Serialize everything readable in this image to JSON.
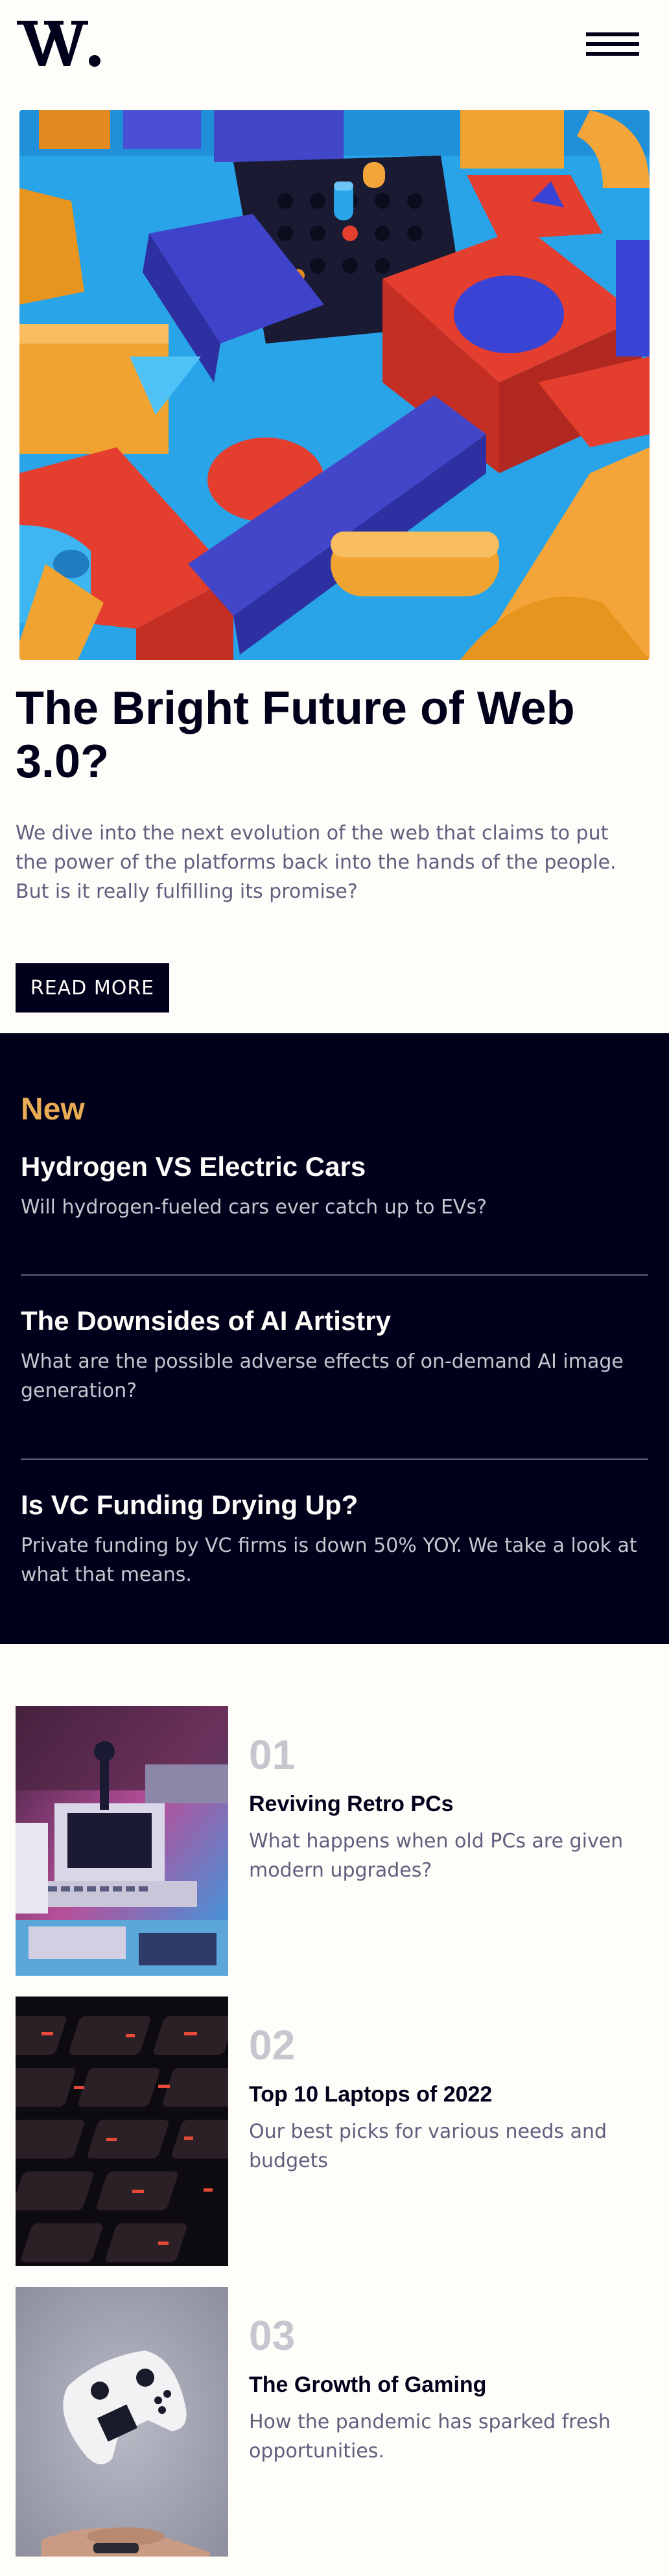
{
  "brand": {
    "logo_text": "W."
  },
  "colors": {
    "background": "#FFFDF9",
    "dark": "#00001A",
    "accent_orange": "#E9AB53",
    "grayish_blue": "#5E607E",
    "light_gray": "#C5C6CE"
  },
  "header": {
    "menu_icon": "hamburger-menu-icon"
  },
  "hero": {
    "image_description_icon": "abstract-3d-blocks-image",
    "title": "The Bright Future of Web 3.0?",
    "text": "We dive into the next evolution of the web that claims to put the power of the platforms back into the hands of the people. But is it really fulfilling its promise?",
    "button_label": "READ MORE"
  },
  "new_section": {
    "heading": "New",
    "items": [
      {
        "title": "Hydrogen VS Electric Cars",
        "description": "Will hydrogen-fueled cars ever catch up to EVs?"
      },
      {
        "title": "The Downsides of AI Artistry",
        "description": "What are the possible adverse effects of on-demand AI image generation?"
      },
      {
        "title": "Is VC Funding Drying Up?",
        "description": "Private funding by VC firms is down 50% YOY. We take a look at what that means."
      }
    ]
  },
  "articles": [
    {
      "number": "01",
      "title": "Reviving Retro PCs",
      "description": "What happens when old PCs are given modern upgrades?"
    },
    {
      "number": "02",
      "title": "Top 10 Laptops of 2022",
      "description": "Our best picks for various needs and budgets"
    },
    {
      "number": "03",
      "title": "The Growth of Gaming",
      "description": "How the pandemic has sparked fresh opportunities."
    }
  ]
}
